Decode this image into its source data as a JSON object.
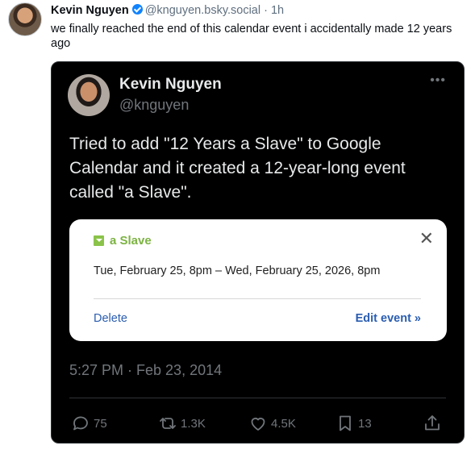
{
  "post": {
    "author_name": "Kevin Nguyen",
    "author_handle": "@knguyen.bsky.social",
    "time": "· 1h",
    "text": "we finally reached the end of this calendar event i accidentally made 12 years ago"
  },
  "embed": {
    "author_name": "Kevin Nguyen",
    "author_handle": "@knguyen",
    "more": "•••",
    "text": "Tried to add \"12 Years a Slave\" to Google Calendar and it created a 12-year-long event called \"a Slave\".",
    "timestamp": "5:27 PM · Feb 23, 2014",
    "popup": {
      "title": "a Slave",
      "close": "✕",
      "when": "Tue, February 25, 8pm – Wed, February 25, 2026, 8pm",
      "delete_label": "Delete",
      "edit_label": "Edit event »"
    },
    "actions": {
      "replies": "75",
      "reposts": "1.3K",
      "likes": "4.5K",
      "bookmarks": "13"
    }
  },
  "colors": {
    "card_bg": "#000000",
    "popup_title": "#7cb342",
    "popup_link": "#2a5db0",
    "verified": "#1083fe"
  }
}
